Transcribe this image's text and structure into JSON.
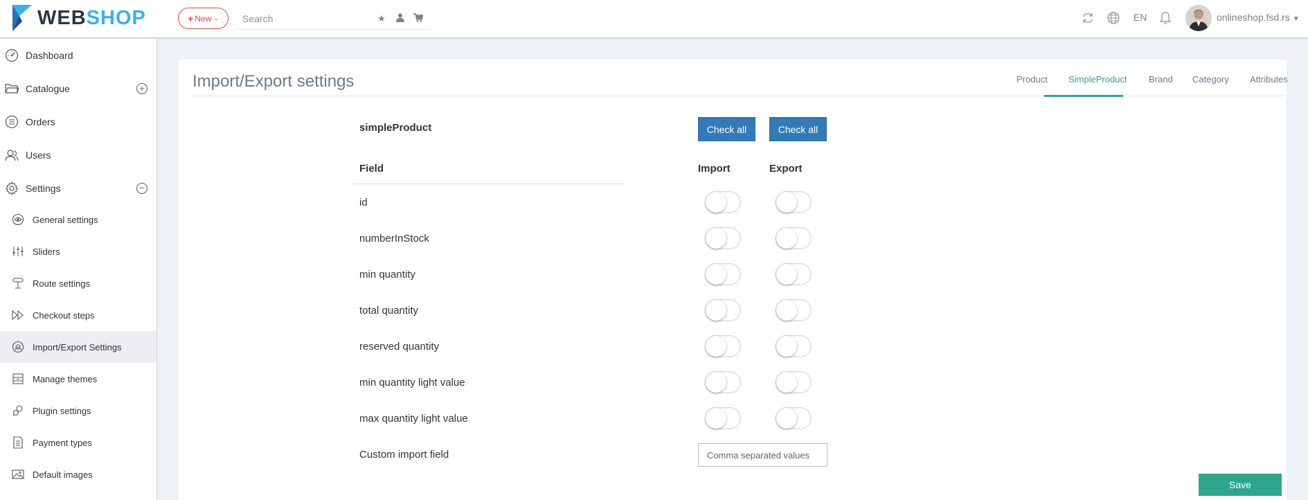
{
  "app": {
    "logo_web": "WEB",
    "logo_shop": "SHOP",
    "new_label": "New",
    "search_placeholder": "Search",
    "language": "EN",
    "account_name": "onlineshop.fsd.rs"
  },
  "sidebar": {
    "items": [
      {
        "label": "Dashboard",
        "icon": "dashboard-icon"
      },
      {
        "label": "Catalogue",
        "icon": "folder-icon",
        "expand": "+"
      },
      {
        "label": "Orders",
        "icon": "list-icon"
      },
      {
        "label": "Users",
        "icon": "users-icon"
      },
      {
        "label": "Settings",
        "icon": "gear-icon",
        "expand": "−"
      }
    ],
    "sub_items": [
      {
        "label": "General settings",
        "icon": "eye-icon"
      },
      {
        "label": "Sliders",
        "icon": "sliders-icon"
      },
      {
        "label": "Route settings",
        "icon": "route-icon"
      },
      {
        "label": "Checkout steps",
        "icon": "fast-forward-icon"
      },
      {
        "label": "Import/Export Settings",
        "icon": "import-export-icon",
        "active": true
      },
      {
        "label": "Manage themes",
        "icon": "themes-icon"
      },
      {
        "label": "Plugin settings",
        "icon": "plugin-icon"
      },
      {
        "label": "Payment types",
        "icon": "document-icon"
      },
      {
        "label": "Default images",
        "icon": "image-icon"
      }
    ]
  },
  "main": {
    "title": "Import/Export settings",
    "tabs": [
      {
        "label": "Product"
      },
      {
        "label": "SimpleProduct",
        "active": true
      },
      {
        "label": "Brand"
      },
      {
        "label": "Category"
      },
      {
        "label": "Attributes"
      }
    ],
    "section": "simpleProduct",
    "check_all_import": "Check all",
    "check_all_export": "Check all",
    "columns": {
      "field": "Field",
      "import": "Import",
      "export": "Export"
    },
    "fields": [
      {
        "name": "id",
        "import": false,
        "export": false
      },
      {
        "name": "numberInStock",
        "import": false,
        "export": false
      },
      {
        "name": "min quantity",
        "import": false,
        "export": false
      },
      {
        "name": "total quantity",
        "import": false,
        "export": false
      },
      {
        "name": "reserved quantity",
        "import": false,
        "export": false
      },
      {
        "name": "min quantity light value",
        "import": false,
        "export": false
      },
      {
        "name": "max quantity light value",
        "import": false,
        "export": false
      }
    ],
    "custom_import_label": "Custom import field",
    "custom_import_placeholder": "Comma separated values",
    "save_label": "Save"
  },
  "colors": {
    "accent_teal": "#2ea58c",
    "button_blue": "#337ab7",
    "new_red": "#e04b4b",
    "logo_blue": "#3db0e6"
  }
}
